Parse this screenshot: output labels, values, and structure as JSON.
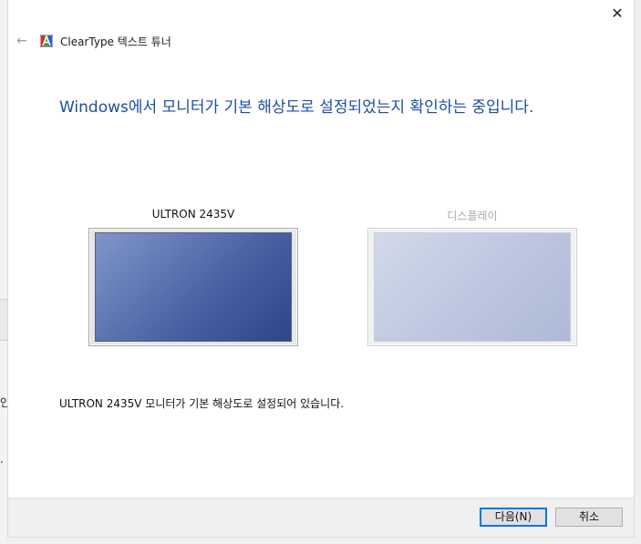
{
  "background": {
    "glyph_1": "인",
    "glyph_2": "."
  },
  "window": {
    "close_icon": "✕",
    "back_icon": "←",
    "app_icon": "cleartype-a-icon",
    "title": "ClearType 텍스트 튜너",
    "heading": "Windows에서 모니터가 기본 해상도로 설정되었는지 확인하는 중입니다.",
    "monitors": [
      {
        "label": "ULTRON 2435V",
        "state": "active"
      },
      {
        "label": "디스플레이",
        "state": "inactive"
      }
    ],
    "status": "ULTRON 2435V 모니터가 기본 해상도로 설정되어 있습니다."
  },
  "footer": {
    "next_label": "다음(N)",
    "cancel_label": "취소"
  },
  "colors": {
    "heading": "#1b4ea3",
    "accent": "#0078d7"
  }
}
